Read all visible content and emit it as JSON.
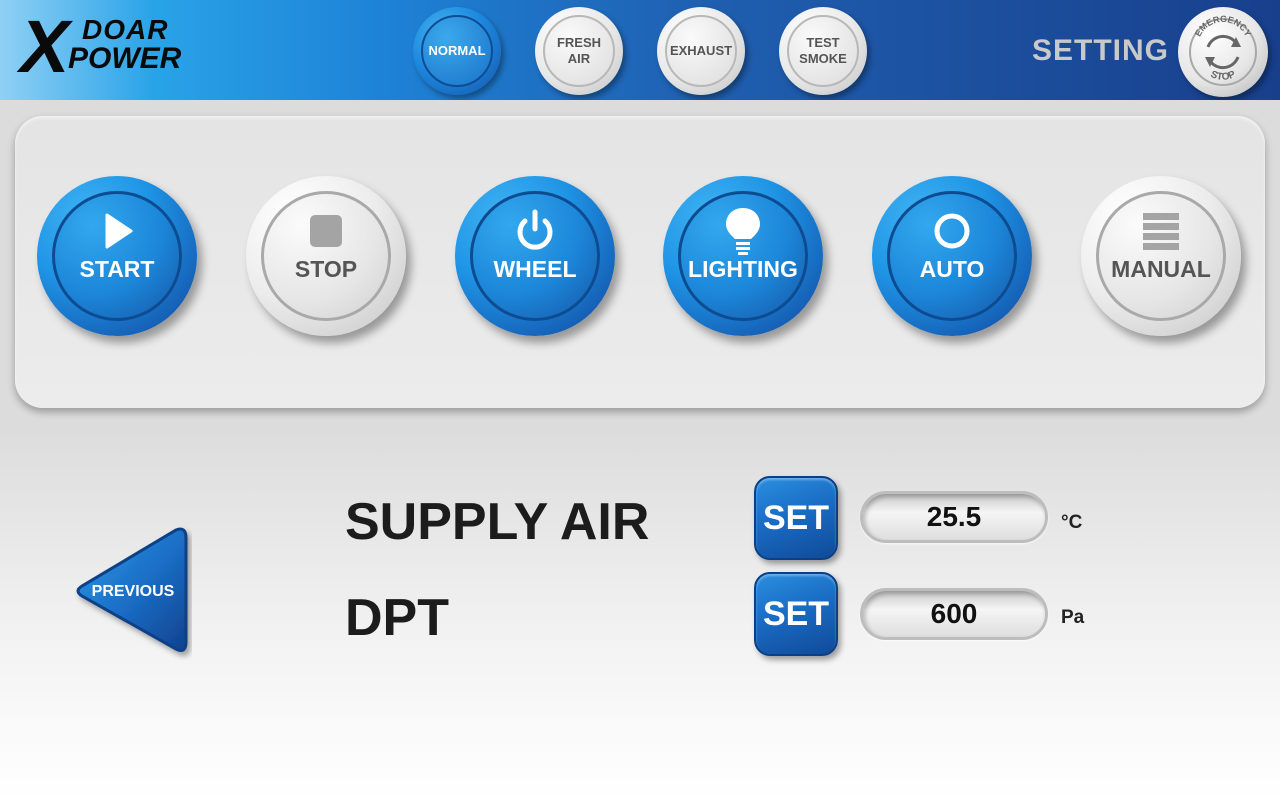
{
  "brand": {
    "line1": "DOAR",
    "line2": "POWER",
    "mark": "X"
  },
  "modes": [
    {
      "label": "NORMAL",
      "active": true
    },
    {
      "label": "FRESH\nAIR",
      "active": false
    },
    {
      "label": "EXHAUST",
      "active": false
    },
    {
      "label": "TEST\nSMOKE",
      "active": false
    }
  ],
  "header": {
    "setting_label": "SETTING"
  },
  "emergency_stop": {
    "top_text": "EMERGENCY",
    "bottom_text": "STOP"
  },
  "controls": [
    {
      "label": "START",
      "icon": "play-icon",
      "style": "blue"
    },
    {
      "label": "STOP",
      "icon": "stop-icon",
      "style": "grey"
    },
    {
      "label": "WHEEL",
      "icon": "power-icon",
      "style": "blue"
    },
    {
      "label": "LIGHTING",
      "icon": "bulb-icon",
      "style": "blue"
    },
    {
      "label": "AUTO",
      "icon": "circle-icon",
      "style": "blue"
    },
    {
      "label": "MANUAL",
      "icon": "menu-icon",
      "style": "grey"
    }
  ],
  "navigation": {
    "previous_label": "PREVIOUS"
  },
  "parameters": [
    {
      "name": "SUPPLY AIR",
      "set_label": "SET",
      "value": "25.5",
      "unit": "°C"
    },
    {
      "name": "DPT",
      "set_label": "SET",
      "value": "600",
      "unit": "Pa"
    }
  ],
  "colors": {
    "accent_blue": "#1f8be0",
    "dark_blue": "#183f8c",
    "grey": "#e6e6e6"
  }
}
